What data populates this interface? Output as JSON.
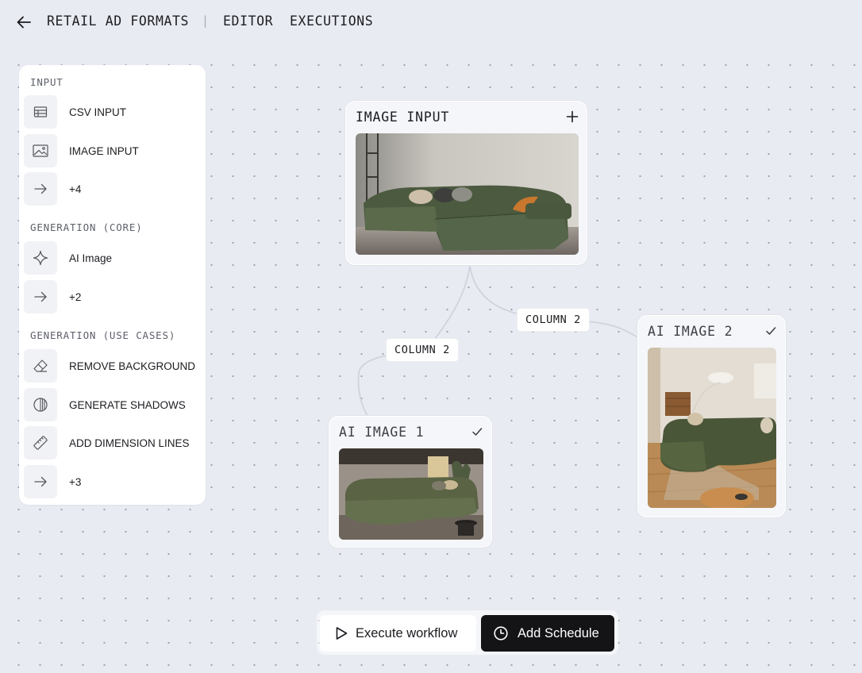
{
  "breadcrumb": {
    "back_icon": "arrow-left-icon",
    "workflow": "RETAIL AD FORMATS",
    "separator": "|",
    "editor": "EDITOR",
    "executions": "EXECUTIONS"
  },
  "palette": {
    "sections": [
      {
        "title": "INPUT",
        "items": [
          {
            "label": "CSV INPUT",
            "icon": "table-icon"
          },
          {
            "label": "IMAGE INPUT",
            "icon": "image-icon"
          },
          {
            "label": "+4",
            "icon": "arrow-right-icon"
          }
        ]
      },
      {
        "title": "GENERATION (CORE)",
        "items": [
          {
            "label": "AI Image",
            "icon": "sparkle-icon"
          },
          {
            "label": "+2",
            "icon": "arrow-right-icon"
          }
        ]
      },
      {
        "title": "GENERATION (USE CASES)",
        "items": [
          {
            "label": "REMOVE BACKGROUND",
            "icon": "eraser-icon"
          },
          {
            "label": "GENERATE SHADOWS",
            "icon": "shadow-circle-icon"
          },
          {
            "label": "ADD DIMENSION LINES",
            "icon": "ruler-icon"
          },
          {
            "label": "+3",
            "icon": "arrow-right-icon"
          }
        ]
      }
    ]
  },
  "canvas": {
    "nodes": {
      "image_input": {
        "title": "IMAGE INPUT",
        "action_icon": "plus-icon"
      },
      "ai_image_1": {
        "title": "AI IMAGE 1",
        "status_icon": "check-icon"
      },
      "ai_image_2": {
        "title": "AI IMAGE 2",
        "status_icon": "check-icon"
      }
    },
    "edges": [
      {
        "label": "COLUMN 2"
      },
      {
        "label": "COLUMN 2"
      }
    ]
  },
  "actions": {
    "execute_label": "Execute workflow",
    "execute_icon": "play-icon",
    "schedule_label": "Add Schedule",
    "schedule_icon": "clock-icon"
  },
  "colors": {
    "canvas_bg": "#e9ebf2",
    "primary_button": "#141417",
    "sofa_green": "#4b5a3e"
  }
}
